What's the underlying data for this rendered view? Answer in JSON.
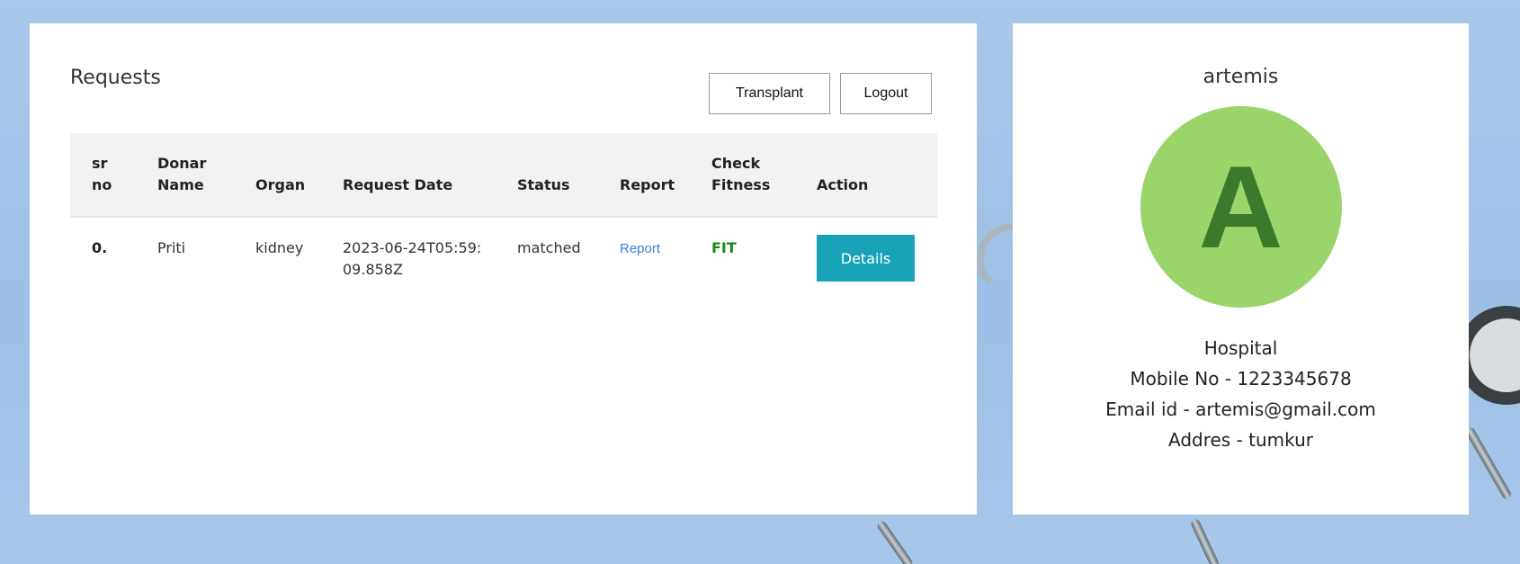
{
  "requests": {
    "title": "Requests",
    "transplant_label": "Transplant",
    "logout_label": "Logout",
    "columns": [
      "sr no",
      "Donar Name",
      "Organ",
      "Request Date",
      "Status",
      "Report",
      "Check Fitness",
      "Action"
    ],
    "rows": [
      {
        "sr": "0.",
        "donar_name": "Priti",
        "organ": "kidney",
        "request_date": "2023-06-24T05:59:09.858Z",
        "status": "matched",
        "report": "Report",
        "fitness": "FIT",
        "action": "Details"
      }
    ]
  },
  "profile": {
    "name": "artemis",
    "avatar_letter": "A",
    "type": "Hospital",
    "mobile": "Mobile No - 1223345678",
    "email": "Email id - artemis@gmail.com",
    "address": "Addres - tumkur"
  },
  "colors": {
    "details_button": "#17a2b8",
    "avatar_bg": "#99d56b",
    "avatar_letter": "#3a7a2a",
    "fit": "#1a8a1a",
    "link": "#3b7ddd"
  }
}
